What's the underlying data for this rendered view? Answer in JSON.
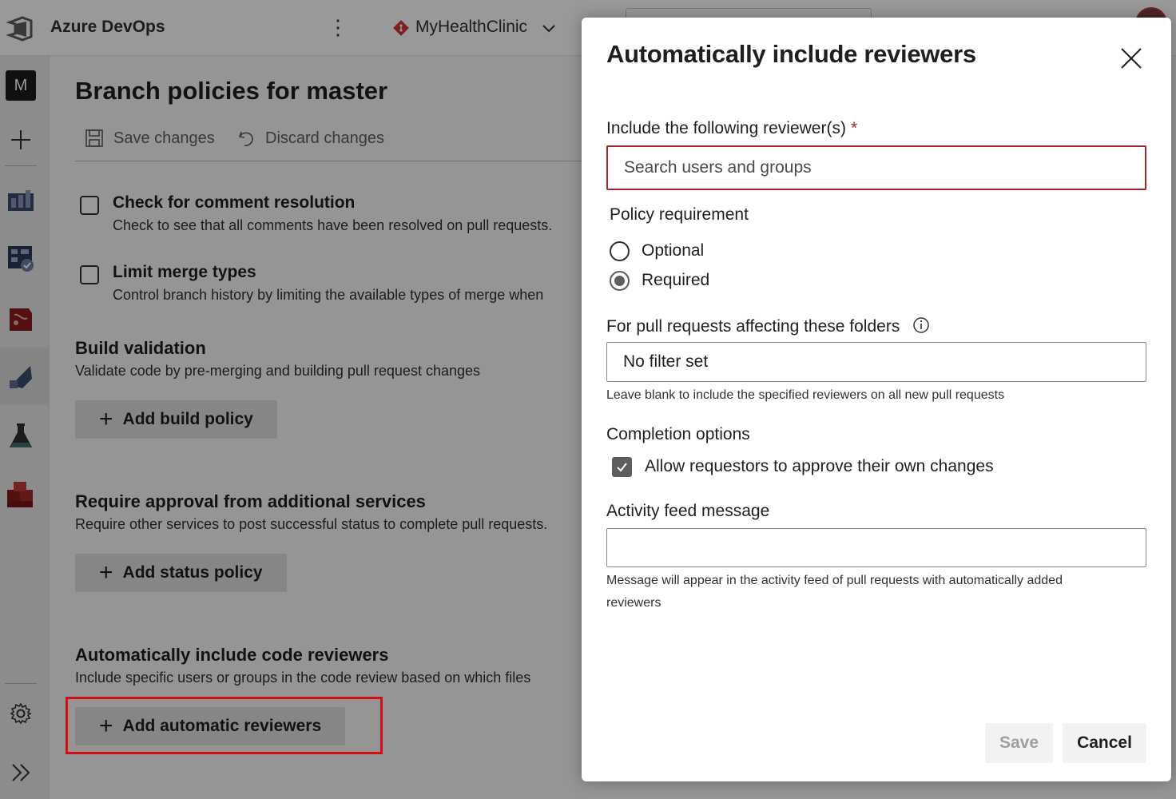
{
  "header": {
    "app_title": "Azure DevOps",
    "project_name": "MyHealthClinic"
  },
  "rail": {
    "org_initial": "M"
  },
  "main": {
    "page_title": "Branch policies for master",
    "save_label": "Save changes",
    "discard_label": "Discard changes",
    "comment_resolution": {
      "title": "Check for comment resolution",
      "desc": "Check to see that all comments have been resolved on pull requests."
    },
    "limit_merge": {
      "title": "Limit merge types",
      "desc": "Control branch history by limiting the available types of merge when"
    },
    "build_validation": {
      "title": "Build validation",
      "desc": "Validate code by pre-merging and building pull request changes",
      "button": "Add build policy"
    },
    "additional_services": {
      "title": "Require approval from additional services",
      "desc": "Require other services to post successful status to complete pull requests.",
      "button": "Add status policy"
    },
    "code_reviewers": {
      "title": "Automatically include code reviewers",
      "desc": "Include specific users or groups in the code review based on which files",
      "button": "Add automatic reviewers"
    }
  },
  "panel": {
    "title": "Automatically include reviewers",
    "reviewers_label": "Include the following reviewer(s)",
    "required_mark": "*",
    "reviewers_placeholder": "Search users and groups",
    "policy_label": "Policy requirement",
    "option_optional": "Optional",
    "option_required": "Required",
    "selected_policy": "Required",
    "folders_label": "For pull requests affecting these folders",
    "folders_value": "No filter set",
    "folders_hint": "Leave blank to include the specified reviewers on all new pull requests",
    "completion_label": "Completion options",
    "allow_self_approve": "Allow requestors to approve their own changes",
    "allow_self_approve_checked": true,
    "activity_label": "Activity feed message",
    "activity_value": "",
    "activity_hint": "Message will appear in the activity feed of pull requests with automatically added reviewers",
    "save_label": "Save",
    "cancel_label": "Cancel"
  },
  "colors": {
    "accent_red": "#d40f14",
    "required_red": "#a4262c",
    "overlay": "rgba(0,0,0,0.40)"
  }
}
